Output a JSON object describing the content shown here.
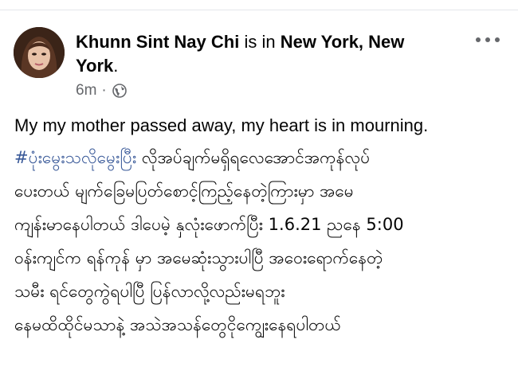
{
  "post": {
    "author": "Khunn Sint Nay Chi",
    "is_in": "is in",
    "location_part1": "New York, New",
    "location_part2": "York",
    "period": ".",
    "time": "6m",
    "dot": "·",
    "privacy_icon": "globe-icon",
    "more_icon": "more-options-icon",
    "body": {
      "line1": "My my mother passed away, my heart is in mourning.",
      "hashtag": "#ပုံးမွေးသလိုမွေးပြီး",
      "line2_rest": " လိုအပ်ချက်မရှိရလေအောင်အကုန်လုပ်",
      "line3": "ပေးတယ် မျက်ခြေမပြတ်စောင့်ကြည့်နေတဲ့ကြားမှာ အမေ",
      "line4": "ကျန်းမာနေပါတယ် ဒါပေမဲ့ နှလုံးဖောက်ပြီး 1.6.21 ညနေ 5:00",
      "line5": "ဝန်းကျင်က ရန်ကုန် မှာ အမေဆုံးသွားပါပြီ အဝေးရောက်နေတဲ့",
      "line6": "သမီး ရင်တွေကွဲရပါပြီ ပြန်လာလို့လည်းမရဘူး",
      "line7": "နေမထိထိုင်မသာနဲ့ အသဲအသန်တွေငိုကျွေးနေရပါတယ်"
    }
  },
  "colors": {
    "text": "#050505",
    "meta": "#65676b",
    "hashtag": "#385898"
  }
}
